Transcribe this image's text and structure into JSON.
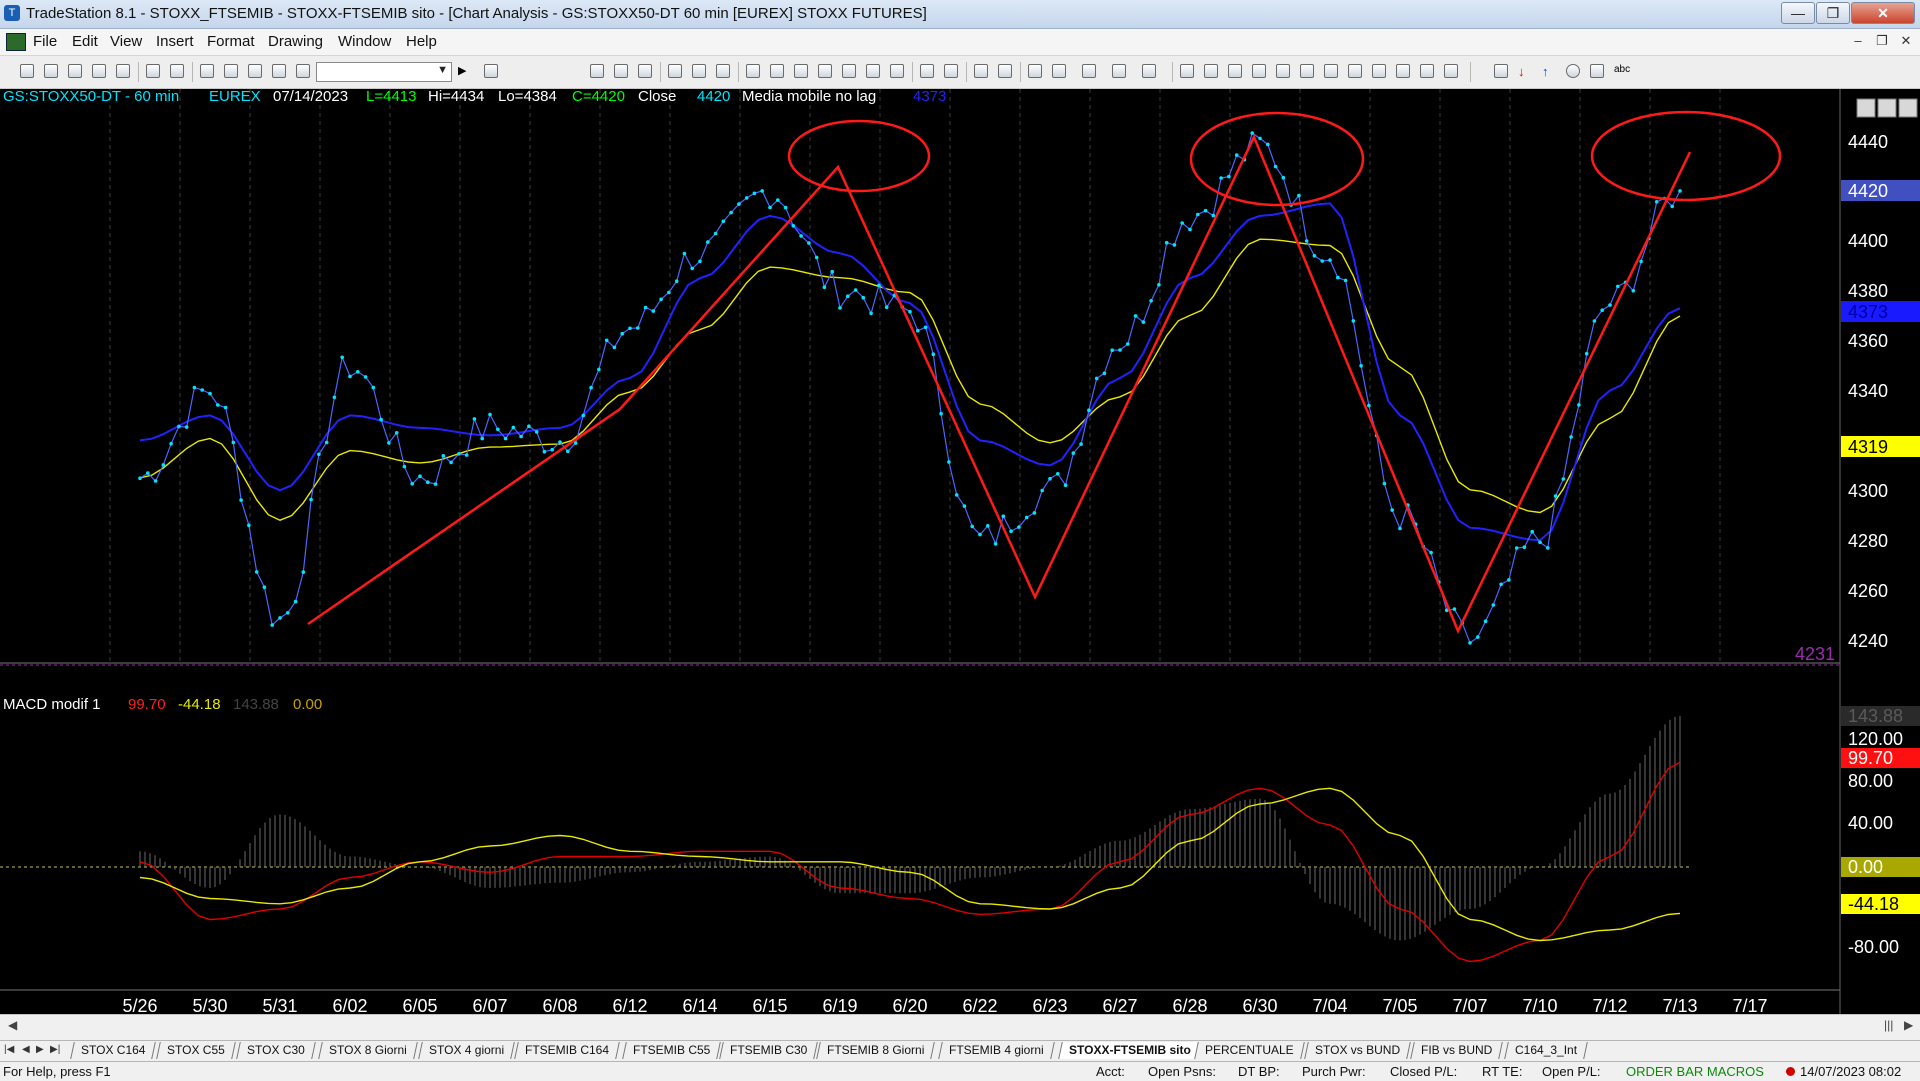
{
  "window": {
    "title": "TradeStation 8.1 - STOXX_FTSEMIB - STOXX-FTSEMIB sito - [Chart Analysis - GS:STOXX50-DT  60 min  [EUREX] STOXX FUTURES]"
  },
  "menu": [
    "File",
    "Edit",
    "View",
    "Insert",
    "Format",
    "Drawing",
    "Window",
    "Help"
  ],
  "header": {
    "symbol": "GS:STOXX50-DT - 60 min",
    "exchange": "EUREX",
    "date": "07/14/2023",
    "low_open": "L=4413",
    "high": "Hi=4434",
    "low": "Lo=4384",
    "close": "C=4420",
    "close_label": "Close",
    "close_value": "4420",
    "indicator_name": "Media mobile no lag",
    "indicator_value": "4373"
  },
  "price_axis": {
    "labels": [
      "4440",
      "4400",
      "4380",
      "4360",
      "4340",
      "4300",
      "4280",
      "4260",
      "4240"
    ],
    "marker_close": "4420",
    "marker_blue": "4373",
    "marker_yellow": "4319",
    "marker_low": "4231"
  },
  "macd": {
    "name": "MACD modif 1",
    "v1": "99.70",
    "v2": "-44.18",
    "v3": "143.88",
    "v4": "0.00",
    "axis_labels": [
      "120.00",
      "80.00",
      "40.00",
      "-80.00"
    ],
    "marker_hist": "143.88",
    "marker_macd": "99.70",
    "marker_zero": "0.00",
    "marker_signal": "-44.18"
  },
  "date_axis": [
    "5/26",
    "5/30",
    "5/31",
    "6/02",
    "6/05",
    "6/07",
    "6/08",
    "6/12",
    "6/14",
    "6/15",
    "6/19",
    "6/20",
    "6/22",
    "6/23",
    "6/27",
    "6/28",
    "6/30",
    "7/04",
    "7/05",
    "7/07",
    "7/10",
    "7/12",
    "7/13",
    "7/17"
  ],
  "colors": {
    "price": "#00e5ff",
    "nolag_ma": "#2222ff",
    "slow_ma": "#e8e800",
    "macd_line": "#e00000",
    "signal_line": "#e8e800",
    "drawing": "#ff1a1a"
  },
  "chart_data": [
    {
      "type": "line",
      "x": [
        "5/26",
        "5/30",
        "5/31",
        "6/02",
        "6/05",
        "6/07",
        "6/08",
        "6/12",
        "6/14",
        "6/15",
        "6/19",
        "6/20",
        "6/22",
        "6/23",
        "6/27",
        "6/28",
        "6/30",
        "7/04",
        "7/05",
        "7/07",
        "7/10",
        "7/12",
        "7/13"
      ],
      "series": [
        {
          "name": "Close",
          "values": [
            4305,
            4340,
            4248,
            4350,
            4305,
            4325,
            4320,
            4365,
            4395,
            4420,
            4380,
            4372,
            4280,
            4300,
            4360,
            4410,
            4438,
            4395,
            4290,
            4240,
            4280,
            4375,
            4420
          ]
        },
        {
          "name": "Media mobile no lag",
          "values": [
            4320,
            4330,
            4300,
            4330,
            4325,
            4322,
            4325,
            4345,
            4385,
            4410,
            4395,
            4375,
            4320,
            4310,
            4345,
            4385,
            4410,
            4415,
            4330,
            4285,
            4280,
            4340,
            4373
          ]
        }
      ],
      "ylim": [
        4230,
        4450
      ]
    },
    {
      "type": "line",
      "x": [
        "5/26",
        "5/30",
        "5/31",
        "6/02",
        "6/05",
        "6/07",
        "6/08",
        "6/12",
        "6/14",
        "6/15",
        "6/19",
        "6/20",
        "6/22",
        "6/23",
        "6/27",
        "6/28",
        "6/30",
        "7/04",
        "7/05",
        "7/07",
        "7/10",
        "7/12",
        "7/13"
      ],
      "series": [
        {
          "name": "MACD",
          "values": [
            5,
            -50,
            -40,
            -10,
            5,
            -5,
            10,
            10,
            15,
            15,
            -20,
            -30,
            -45,
            -40,
            5,
            50,
            75,
            40,
            -40,
            -90,
            -70,
            10,
            99.7
          ]
        },
        {
          "name": "Signal",
          "values": [
            -10,
            -30,
            -35,
            -20,
            5,
            20,
            30,
            15,
            10,
            5,
            5,
            -5,
            -35,
            -40,
            -20,
            25,
            60,
            75,
            30,
            -50,
            -70,
            -60,
            -44.18
          ]
        },
        {
          "name": "Histogram",
          "values": [
            15,
            -20,
            50,
            10,
            0,
            -20,
            -15,
            -5,
            5,
            10,
            -25,
            -25,
            -10,
            0,
            25,
            55,
            65,
            -35,
            -70,
            -40,
            0,
            70,
            143.88
          ]
        }
      ],
      "ylim": [
        -95,
        150
      ]
    }
  ],
  "sheet_tabs": [
    "STOX C164",
    "STOX C55",
    "STOX  C30",
    "STOX  8 Giorni",
    "STOX 4 giorni",
    "FTSEMIB C164",
    "FTSEMIB C55",
    "FTSEMIB C30",
    "FTSEMIB  8 Giorni",
    "FTSEMIB  4 giorni",
    "STOXX-FTSEMIB sito",
    "PERCENTUALE",
    "STOX vs BUND",
    "FIB vs BUND",
    "C164_3_Int"
  ],
  "status": {
    "help": "For Help, press F1",
    "acct": "Acct:",
    "open_psns": "Open Psns:",
    "dt_bp": "DT BP:",
    "purch_pwr": "Purch Pwr:",
    "closed_pl": "Closed P/L:",
    "rt_te": "RT TE:",
    "open_pl": "Open P/L:",
    "order_bar": "ORDER BAR  MACROS",
    "datetime": "14/07/2023 08:02"
  }
}
